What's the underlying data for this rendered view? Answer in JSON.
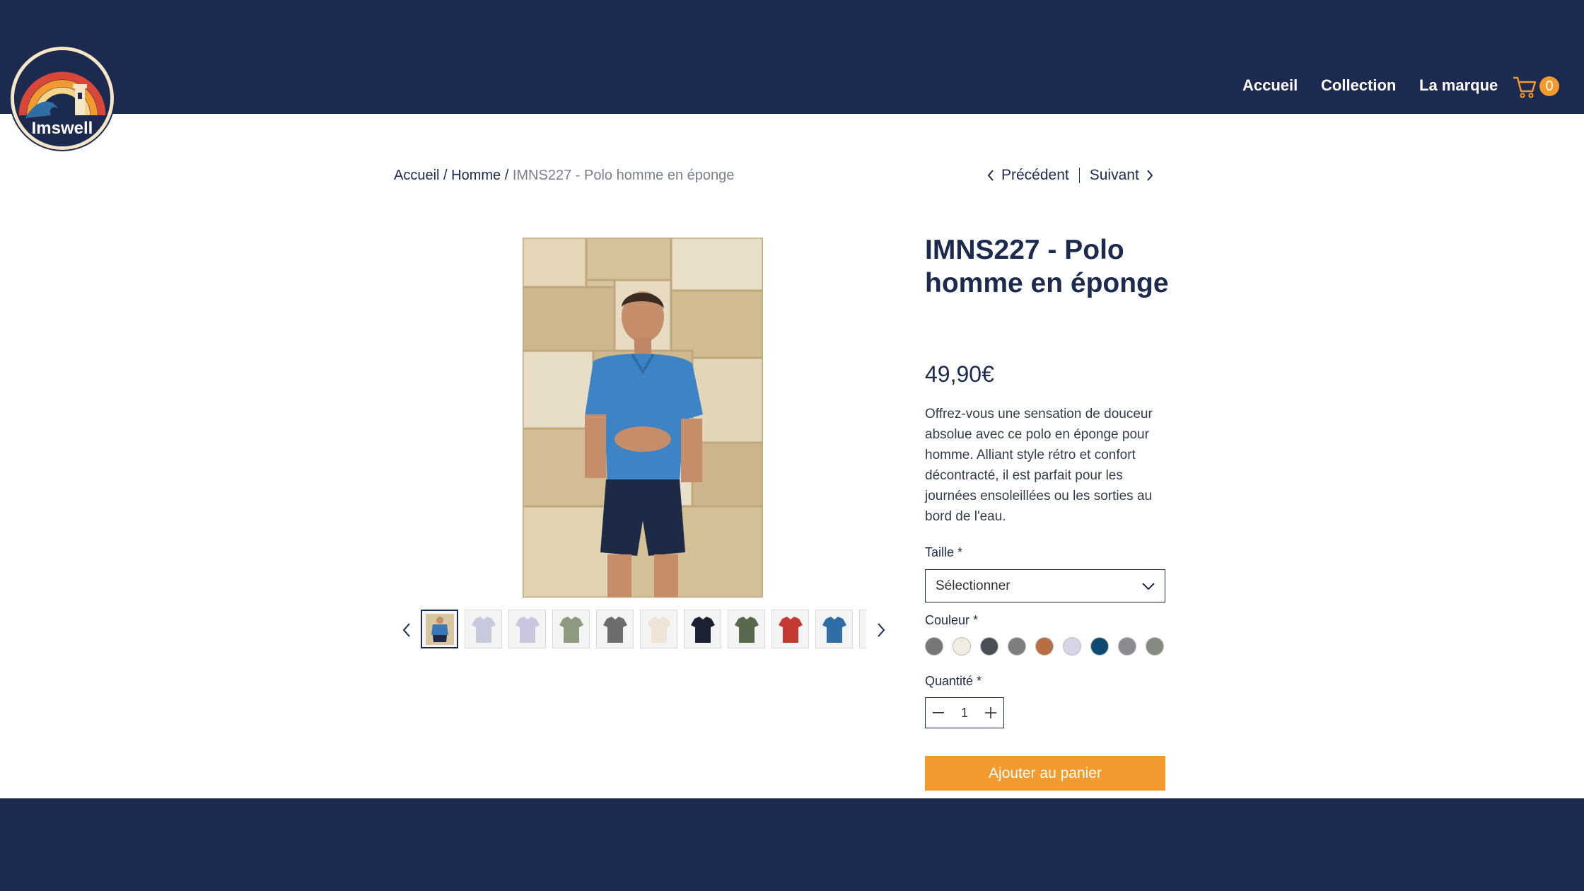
{
  "brand": {
    "name": "Imswell"
  },
  "nav": {
    "items": [
      "Accueil",
      "Collection",
      "La marque"
    ],
    "cart_count": "0"
  },
  "breadcrumb": {
    "home": "Accueil",
    "category": "Homme",
    "current": "IMNS227 - Polo homme en éponge"
  },
  "pager": {
    "prev": "Précédent",
    "next": "Suivant"
  },
  "gallery": {
    "thumbnail_colors": [
      "#3a78b5",
      "#c8c9dc",
      "#c9c7e0",
      "#8d9a7f",
      "#6b6d6e",
      "#ede4d6",
      "#1c2233",
      "#596a4c",
      "#c43a32",
      "#2f6da5"
    ]
  },
  "product": {
    "title": "IMNS227 - Polo homme en éponge",
    "price": "49,90€",
    "description": "Offrez-vous une sensation de douceur absolue avec ce polo en éponge pour homme. Alliant style rétro et confort décontracté, il est parfait pour les journées ensoleillées ou les sorties au bord de l'eau."
  },
  "options": {
    "size_label": "Taille *",
    "size_placeholder": "Sélectionner",
    "color_label": "Couleur *",
    "colors": [
      "#777777",
      "#f2ede1",
      "#4a4f57",
      "#7e7e7e",
      "#b86d42",
      "#d6d5e6",
      "#0f4a70",
      "#8a8b90",
      "#868b80"
    ],
    "quantity_label": "Quantité *",
    "quantity": "1"
  },
  "add_to_cart": "Ajouter au panier",
  "colors": {
    "navy": "#1c2a4f",
    "accent": "#f29a2e"
  }
}
